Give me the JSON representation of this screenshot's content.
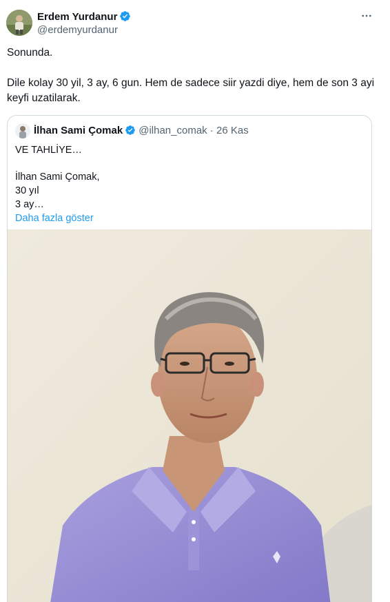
{
  "tweet": {
    "author": {
      "name": "Erdem Yurdanur",
      "handle": "@erdemyurdanur",
      "verified": true
    },
    "more_icon": "more-icon",
    "text_line1": "Sonunda.",
    "text_line2": "Dile kolay 30 yil, 3 ay, 6 gun. Hem de sadece siir yazdi diye, hem de son 3 ayi keyfi uzatilarak."
  },
  "quote": {
    "author": {
      "name": "İlhan Sami Çomak",
      "handle": "@ilhan_comak",
      "verified": true
    },
    "meta": "@ilhan_comak · 26 Kas",
    "lines": [
      "VE TAHLİYE…",
      "İlhan Sami Çomak,",
      "30 yıl",
      "3 ay…"
    ],
    "show_more": "Daha fazla göster"
  },
  "colors": {
    "link": "#1d9bf0",
    "secondary_text": "#536471",
    "border": "#cfd9de",
    "verified": "#1d9bf0",
    "shirt": "#9a90d6"
  }
}
